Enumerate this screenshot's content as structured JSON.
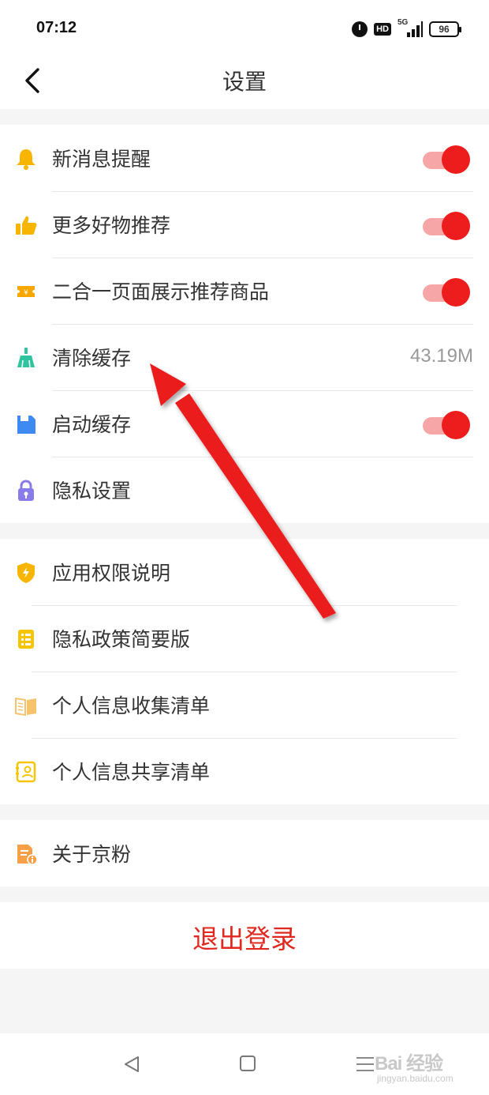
{
  "status": {
    "time": "07:12",
    "hd": "HD",
    "network": "5G",
    "battery": "96"
  },
  "header": {
    "title": "设置"
  },
  "group1": [
    {
      "label": "新消息提醒",
      "icon": "bell-icon",
      "toggle": "on"
    },
    {
      "label": "更多好物推荐",
      "icon": "thumbs-up-icon",
      "toggle": "on"
    },
    {
      "label": "二合一页面展示推荐商品",
      "icon": "ticket-icon",
      "toggle": "on"
    },
    {
      "label": "清除缓存",
      "icon": "broom-icon",
      "value": "43.19M"
    },
    {
      "label": "启动缓存",
      "icon": "floppy-disk-icon",
      "toggle": "on"
    },
    {
      "label": "隐私设置",
      "icon": "lock-icon"
    }
  ],
  "group2": [
    {
      "label": "应用权限说明",
      "icon": "shield-icon"
    },
    {
      "label": "隐私政策简要版",
      "icon": "list-icon"
    },
    {
      "label": "个人信息收集清单",
      "icon": "book-icon"
    },
    {
      "label": "个人信息共享清单",
      "icon": "contact-card-icon"
    }
  ],
  "group3": [
    {
      "label": "关于京粉",
      "icon": "info-document-icon"
    }
  ],
  "logout": {
    "label": "退出登录"
  },
  "watermark": {
    "text": "Bai 经验",
    "sub": "jingyan.baidu.com"
  },
  "colors": {
    "accent": "#ee1d1d",
    "logout": "#e0281f"
  }
}
